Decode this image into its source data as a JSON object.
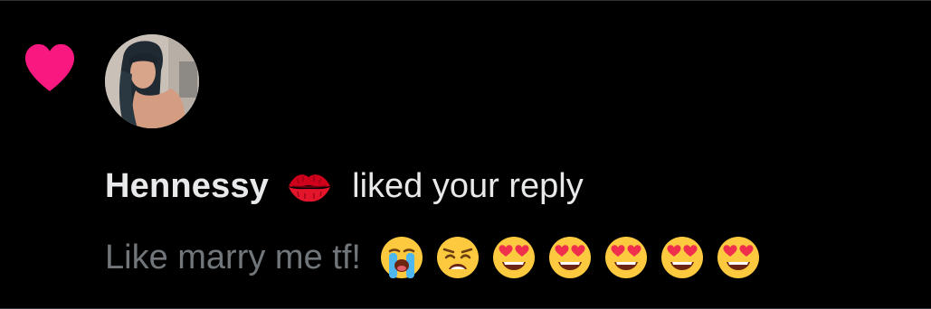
{
  "notification": {
    "user_name": "Hennessy",
    "name_emoji_icon": "kiss-mark-icon",
    "action_text": "liked your reply",
    "reply_text": "Like marry me tf!",
    "reply_emojis": [
      "loudly-crying-face-icon",
      "weary-face-icon",
      "heart-eyes-face-icon",
      "heart-eyes-face-icon",
      "heart-eyes-face-icon",
      "heart-eyes-face-icon",
      "heart-eyes-face-icon"
    ],
    "type_icon": "heart-icon"
  },
  "colors": {
    "background": "#000000",
    "heart": "#f91880",
    "primary_text": "#e7e9ea",
    "secondary_text": "#71767b"
  }
}
